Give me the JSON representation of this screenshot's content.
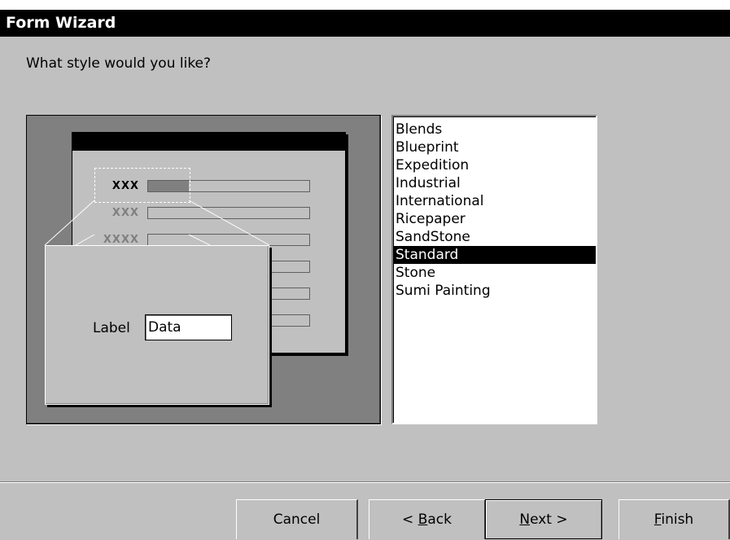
{
  "window": {
    "title": "Form Wizard"
  },
  "prompt": "What style would you like?",
  "preview": {
    "field_labels": [
      "XXX",
      "XXX",
      "XXXX"
    ],
    "zoom_label": "Label",
    "zoom_data": "Data"
  },
  "styles": {
    "items": [
      "Blends",
      "Blueprint",
      "Expedition",
      "Industrial",
      "International",
      "Ricepaper",
      "SandStone",
      "Standard",
      "Stone",
      "Sumi Painting"
    ],
    "selected": "Standard"
  },
  "buttons": {
    "cancel": "Cancel",
    "back": "< Back",
    "next": "Next >",
    "finish": "Finish"
  }
}
